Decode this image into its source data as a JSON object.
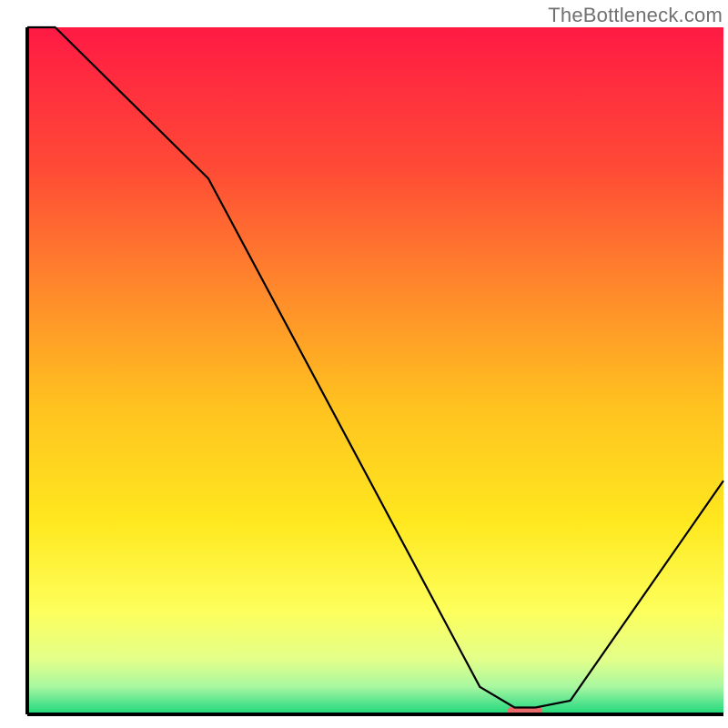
{
  "watermark": "TheBottleneck.com",
  "chart_data": {
    "type": "line",
    "title": "",
    "xlabel": "",
    "ylabel": "",
    "xlim": [
      0,
      100
    ],
    "ylim": [
      0,
      100
    ],
    "x": [
      0,
      4,
      26,
      65,
      70,
      73,
      78,
      100
    ],
    "values": [
      100,
      100,
      78,
      4,
      1,
      1,
      2,
      34
    ],
    "gradient_stops": [
      {
        "offset": 0.0,
        "color": "#ff1a44"
      },
      {
        "offset": 0.2,
        "color": "#ff4936"
      },
      {
        "offset": 0.4,
        "color": "#ff8f2a"
      },
      {
        "offset": 0.55,
        "color": "#ffc21f"
      },
      {
        "offset": 0.72,
        "color": "#ffe81f"
      },
      {
        "offset": 0.85,
        "color": "#fdff5c"
      },
      {
        "offset": 0.92,
        "color": "#e3ff8a"
      },
      {
        "offset": 0.96,
        "color": "#a8f7a0"
      },
      {
        "offset": 0.985,
        "color": "#4fe28c"
      },
      {
        "offset": 1.0,
        "color": "#1fd977"
      }
    ],
    "marker": {
      "x": 71.5,
      "y": 0.5,
      "width": 5,
      "height": 1.2,
      "color": "#ea6a6c"
    },
    "axes_color": "#000000",
    "line_color": "#000000"
  }
}
